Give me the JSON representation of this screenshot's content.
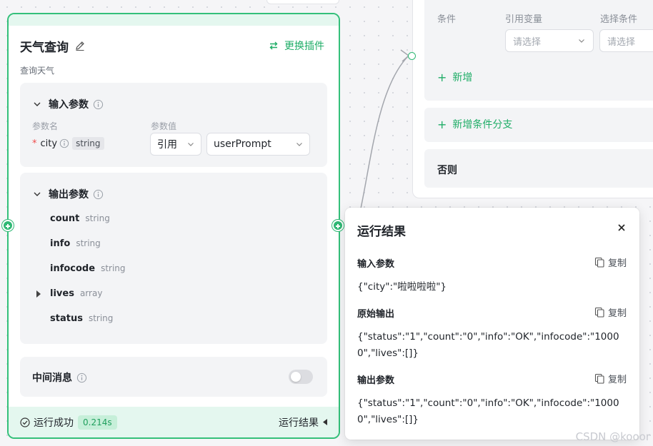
{
  "plugin_node": {
    "title": "天气查询",
    "switch_plugin_label": "更换插件",
    "description": "查询天气",
    "input_section": {
      "title": "输入参数",
      "col_param_name": "参数名",
      "col_param_value": "参数值",
      "params": [
        {
          "name": "city",
          "type": "string",
          "source": "引用",
          "value": "userPrompt"
        }
      ]
    },
    "output_section": {
      "title": "输出参数",
      "params": [
        {
          "name": "count",
          "type": "string"
        },
        {
          "name": "info",
          "type": "string"
        },
        {
          "name": "infocode",
          "type": "string"
        },
        {
          "name": "lives",
          "type": "array"
        },
        {
          "name": "status",
          "type": "string"
        }
      ]
    },
    "middle_message": {
      "label": "中间消息",
      "enabled": false
    },
    "footer": {
      "status": "运行成功",
      "duration": "0.214s",
      "run_result_label": "运行结果"
    }
  },
  "condition_node": {
    "col_condition": "条件",
    "col_ref_var": "引用变量",
    "col_select_cond": "选择条件",
    "ref_placeholder": "请选择",
    "cond_placeholder": "请选择",
    "add_label": "新增",
    "add_branch_label": "新增条件分支",
    "else_label": "否则"
  },
  "run_result": {
    "title": "运行结果",
    "copy_label": "复制",
    "input_label": "输入参数",
    "input_json": "{\"city\":\"啦啦啦啦\"}",
    "raw_output_label": "原始输出",
    "raw_output_json": "{\"status\":\"1\",\"count\":\"0\",\"info\":\"OK\",\"infocode\":\"10000\",\"lives\":[]}",
    "output_label": "输出参数",
    "output_json": "{\"status\":\"1\",\"count\":\"0\",\"info\":\"OK\",\"infocode\":\"10000\",\"lives\":[]}"
  },
  "watermark": "CSDN @kooor",
  "colors": {
    "accent": "#2fb874",
    "accent_text": "#1fad67",
    "node_header_bg": "#e4f7ef"
  }
}
